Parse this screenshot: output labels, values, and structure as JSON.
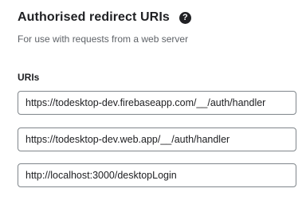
{
  "section": {
    "title": "Authorised redirect URIs",
    "help_icon": "help-circle-icon",
    "help_glyph": "?",
    "subtitle": "For use with requests from a web server",
    "uris_label": "URIs",
    "uris": [
      "https://todesktop-dev.firebaseapp.com/__/auth/handler",
      "https://todesktop-dev.web.app/__/auth/handler",
      "http://localhost:3000/desktopLogin"
    ]
  },
  "colors": {
    "text": "#202124",
    "secondary_text": "#5f6368",
    "field_border": "#80868b",
    "background": "#ffffff"
  }
}
